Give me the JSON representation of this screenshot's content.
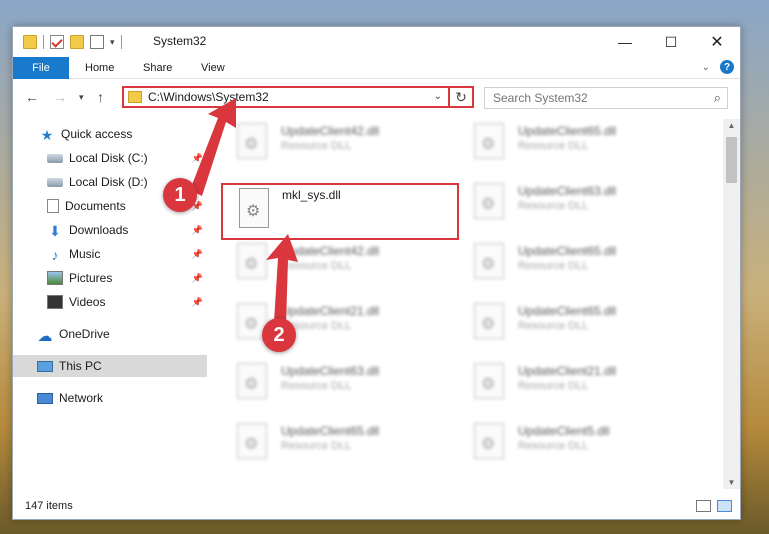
{
  "window": {
    "title": "System32"
  },
  "controls": {
    "minimize": "—",
    "maximize": "☐",
    "close": "✕"
  },
  "ribbon": {
    "tabs": [
      "File",
      "Home",
      "Share",
      "View"
    ]
  },
  "nav": {
    "address": "C:\\Windows\\System32",
    "search_placeholder": "Search System32"
  },
  "sidebar": {
    "items": [
      {
        "label": "Quick access",
        "icon": "star-icon"
      },
      {
        "label": "Local Disk (C:)",
        "icon": "drive-icon",
        "pinned": true
      },
      {
        "label": "Local Disk (D:)",
        "icon": "drive-icon"
      },
      {
        "label": "Documents",
        "icon": "documents-icon",
        "pinned": true
      },
      {
        "label": "Downloads",
        "icon": "downloads-icon",
        "pinned": true
      },
      {
        "label": "Music",
        "icon": "music-icon",
        "pinned": true
      },
      {
        "label": "Pictures",
        "icon": "pictures-icon",
        "pinned": true
      },
      {
        "label": "Videos",
        "icon": "videos-icon",
        "pinned": true
      },
      {
        "label": "OneDrive",
        "icon": "onedrive-icon"
      },
      {
        "label": "This PC",
        "icon": "this-pc-icon",
        "selected": true
      },
      {
        "label": "Network",
        "icon": "network-icon"
      }
    ]
  },
  "files": [
    {
      "name": "UpdateClient42.dll",
      "type": "Resource DLL"
    },
    {
      "name": "UpdateClient65.dll",
      "type": "Resource DLL"
    },
    {
      "name": "mkl_sys.dll",
      "type": "",
      "highlighted": true
    },
    {
      "name": "UpdateClient63.dll",
      "type": "Resource DLL"
    },
    {
      "name": "UpdateClient42.dll",
      "type": "Resource DLL"
    },
    {
      "name": "UpdateClient65.dll",
      "type": "Resource DLL"
    },
    {
      "name": "UpdateClient21.dll",
      "type": "Resource DLL"
    },
    {
      "name": "UpdateClient65.dll",
      "type": "Resource DLL"
    },
    {
      "name": "UpdateClient63.dll",
      "type": "Resource DLL"
    },
    {
      "name": "UpdateClient21.dll",
      "type": "Resource DLL"
    },
    {
      "name": "UpdateClient65.dll",
      "type": "Resource DLL"
    },
    {
      "name": "UpdateClient5.dll",
      "type": "Resource DLL"
    }
  ],
  "status": {
    "count": "147 items"
  },
  "callouts": [
    "1",
    "2"
  ],
  "colors": {
    "accent": "#1979ca",
    "highlight": "#d9363e"
  }
}
